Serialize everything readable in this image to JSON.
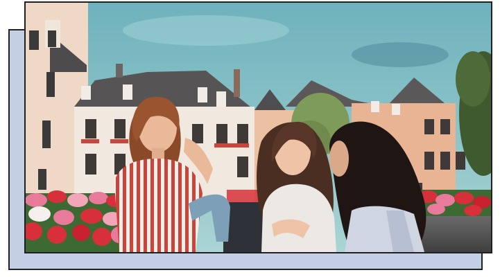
{
  "image": {
    "subject": "photo",
    "colors": {
      "backdrop": "#c3d0e3",
      "frame_border": "#1f1f24",
      "sky": "#79b9c2",
      "building_light": "#f0e5d8",
      "building_peach": "#e8b898",
      "roof": "#5a5858",
      "tulip_red": "#d8303a",
      "tulip_pink": "#e87a9a",
      "stripe_red": "#c8453e",
      "hair_dark": "#2a1c18",
      "hair_auburn": "#8a4a2a"
    }
  }
}
